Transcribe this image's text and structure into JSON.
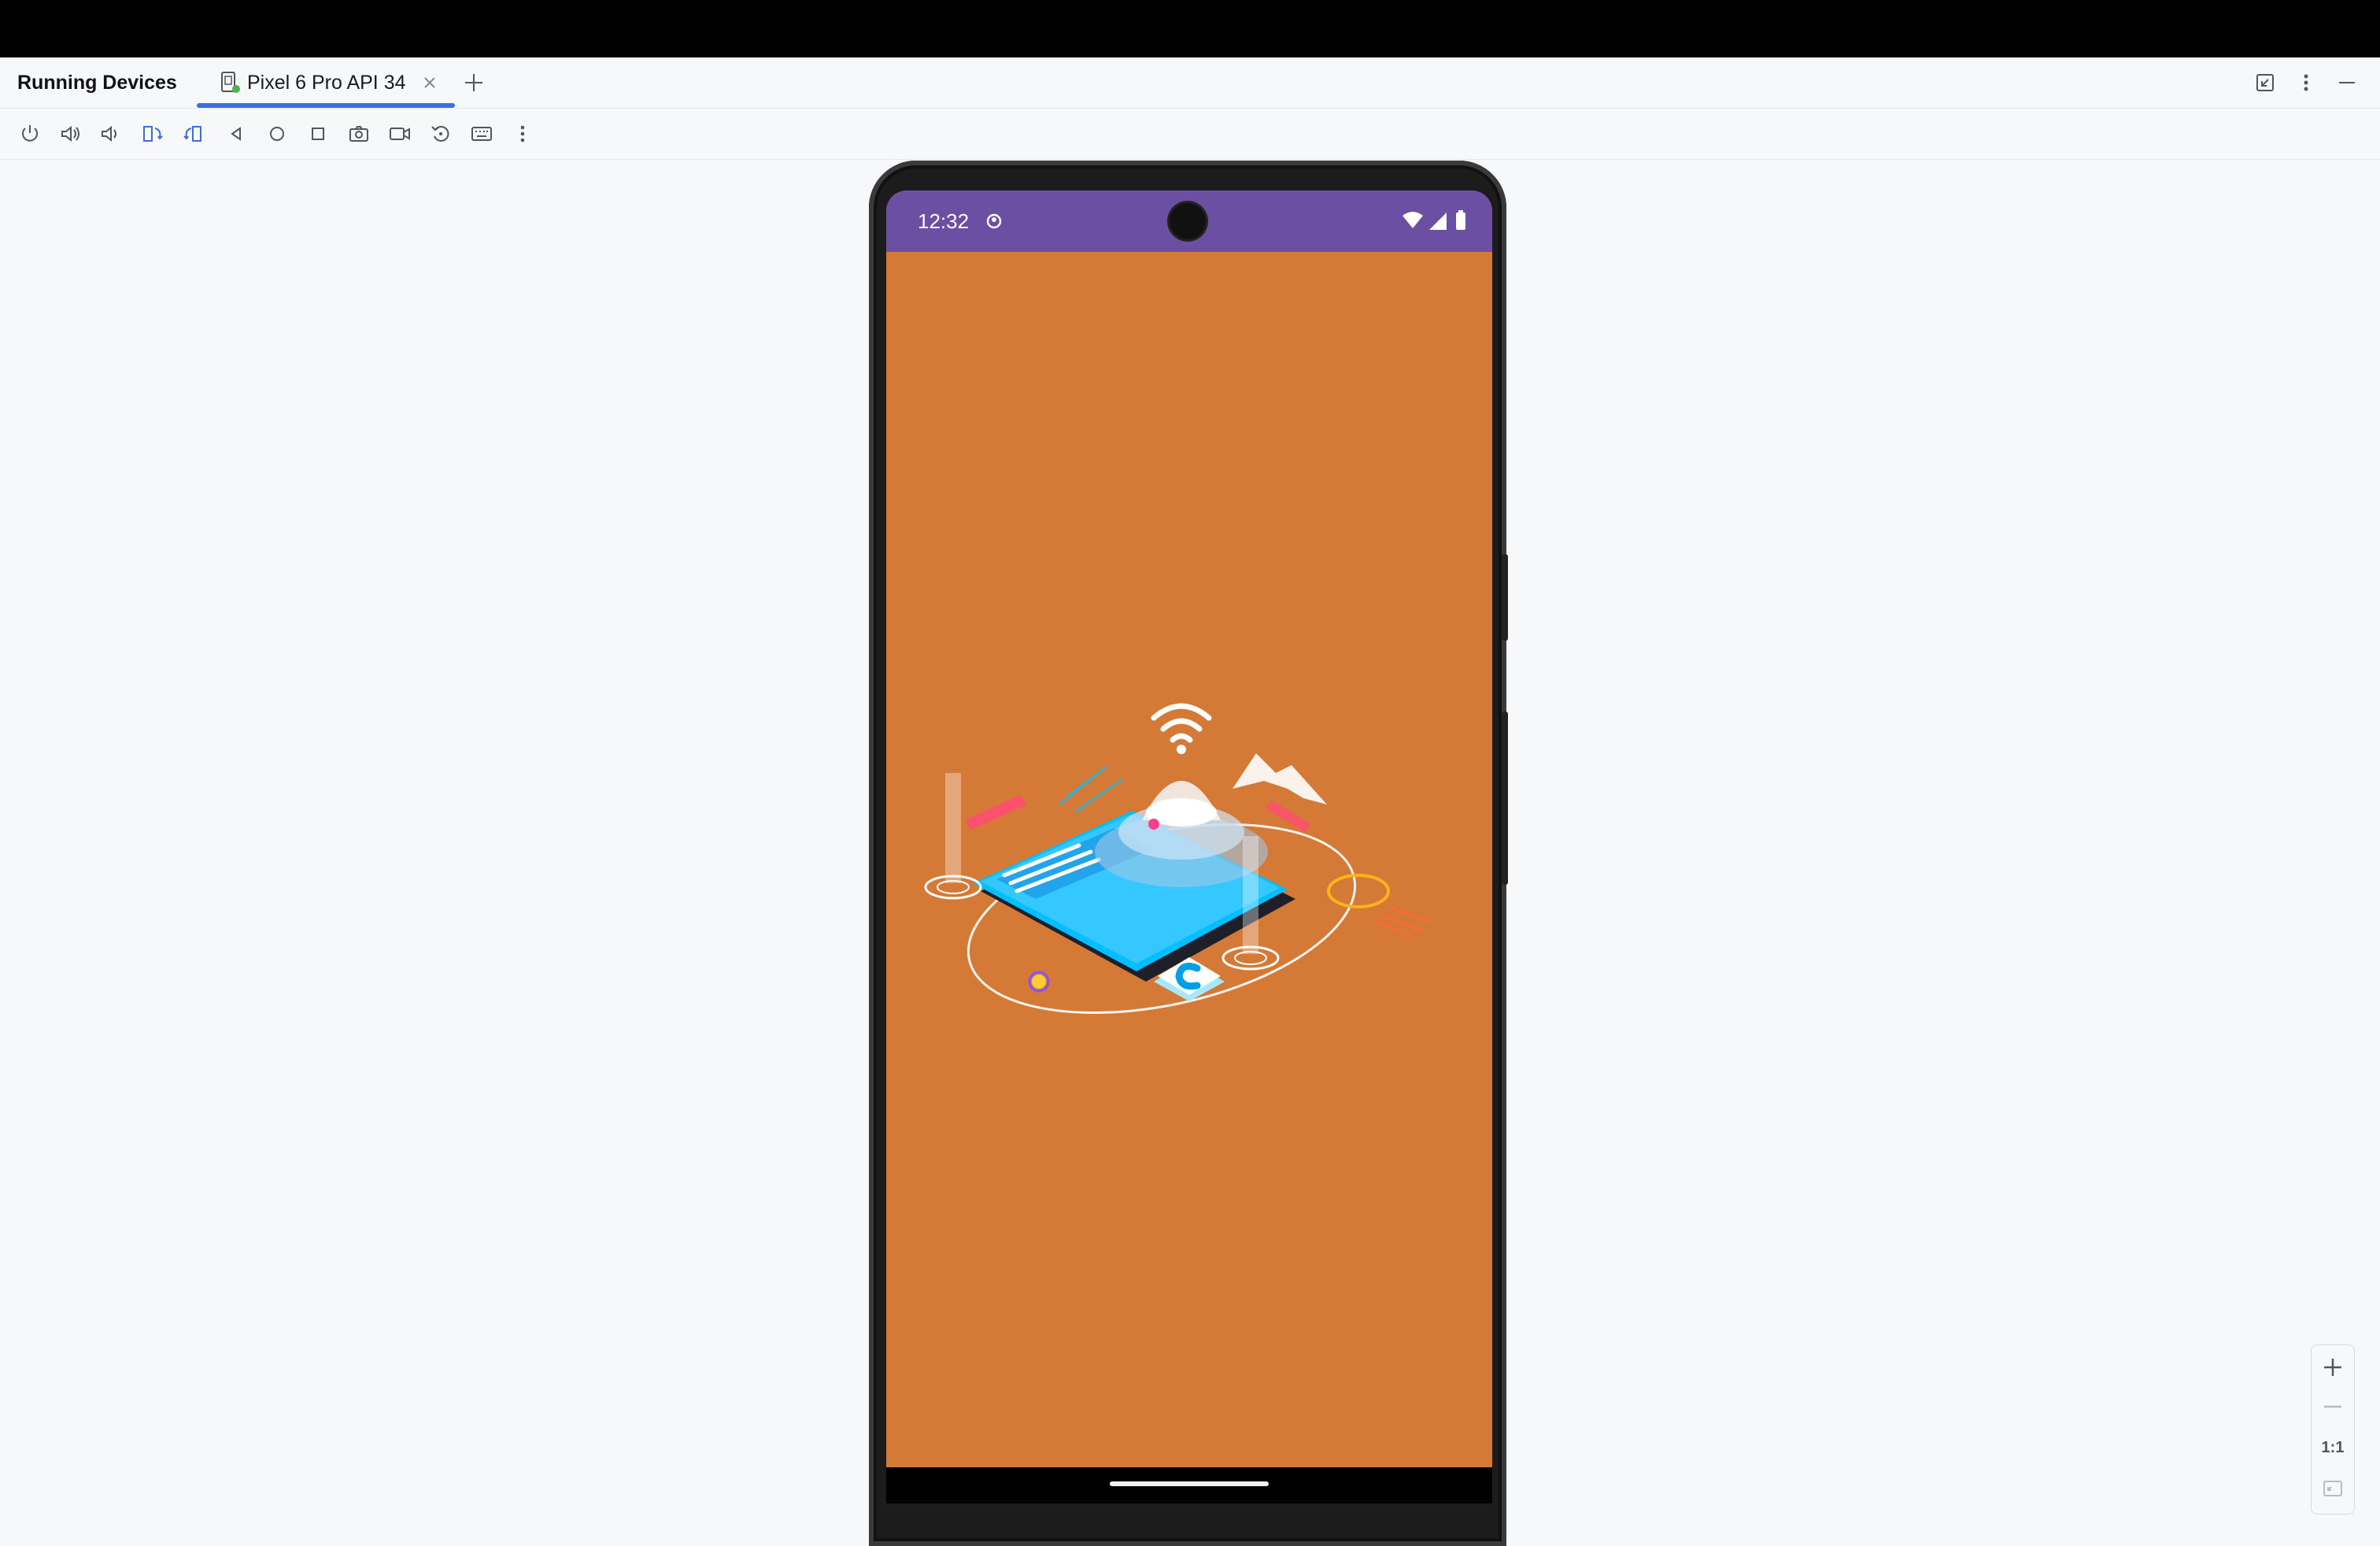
{
  "window": {
    "tool_title": "Running Devices",
    "tab_label": "Pixel 6 Pro API 34"
  },
  "toolbar": {
    "buttons": [
      "power-icon",
      "volume-up-icon",
      "volume-down-icon",
      "rotate-left-icon",
      "rotate-right-icon",
      "back-icon",
      "home-icon",
      "overview-icon",
      "screenshot-icon",
      "screen-record-icon",
      "reset-icon",
      "keyboard-icon",
      "more-vert-icon"
    ]
  },
  "device": {
    "status_time": "12:32",
    "status_bar_color": "#6a4fa3",
    "screen_color": "#d47936"
  },
  "zoom": {
    "actual_size_label": "1:1"
  },
  "colors": {
    "accent": "#3b6fe0"
  }
}
